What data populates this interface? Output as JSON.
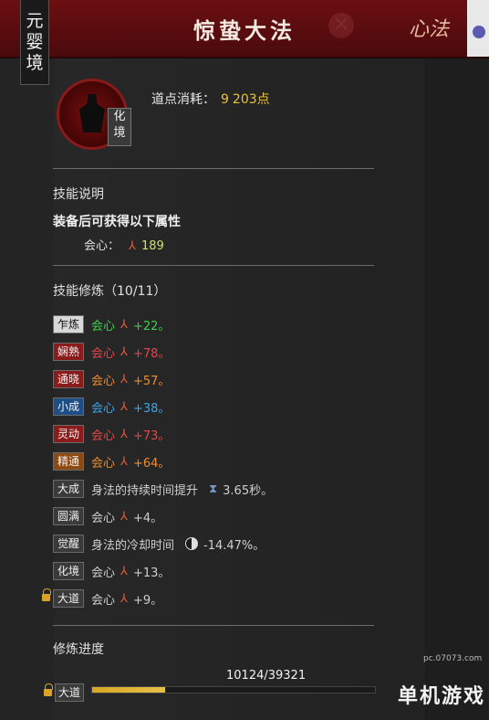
{
  "header": {
    "realm": [
      "元",
      "婴",
      "境"
    ],
    "title": "惊蛰大法",
    "corner_tag": "心法"
  },
  "skill": {
    "tier_badge": "化境",
    "cost_label": "道点消耗：",
    "cost_value": "203点"
  },
  "description": {
    "title": "技能说明",
    "text": "装备后可获得以下属性",
    "stat_label": "会心：",
    "stat_value": "189"
  },
  "training": {
    "title": "技能修炼（10/11）",
    "rows": [
      {
        "level": "乍炼",
        "attr": "会心",
        "value": "+22。"
      },
      {
        "level": "娴熟",
        "attr": "会心",
        "value": "+78。"
      },
      {
        "level": "通晓",
        "attr": "会心",
        "value": "+57。"
      },
      {
        "level": "小成",
        "attr": "会心",
        "value": "+38。"
      },
      {
        "level": "灵动",
        "attr": "会心",
        "value": "+73。"
      },
      {
        "level": "精通",
        "attr": "会心",
        "value": "+64。"
      },
      {
        "level": "大成",
        "attr": "身法的持续时间提升",
        "value": "3.65秒。"
      },
      {
        "level": "圆满",
        "attr": "会心",
        "value": "+4。"
      },
      {
        "level": "觉醒",
        "attr": "身法的冷却时间",
        "value": "-14.47%。"
      },
      {
        "level": "化境",
        "attr": "会心",
        "value": "+13。"
      },
      {
        "level": "大道",
        "attr": "会心",
        "value": "+9。"
      }
    ]
  },
  "progress": {
    "title": "修炼进度",
    "text": "10124/39321",
    "current": 10124,
    "total": 39321,
    "label": "大道"
  },
  "watermark": {
    "brand": "单机游戏",
    "url": "pc.07073.com"
  }
}
